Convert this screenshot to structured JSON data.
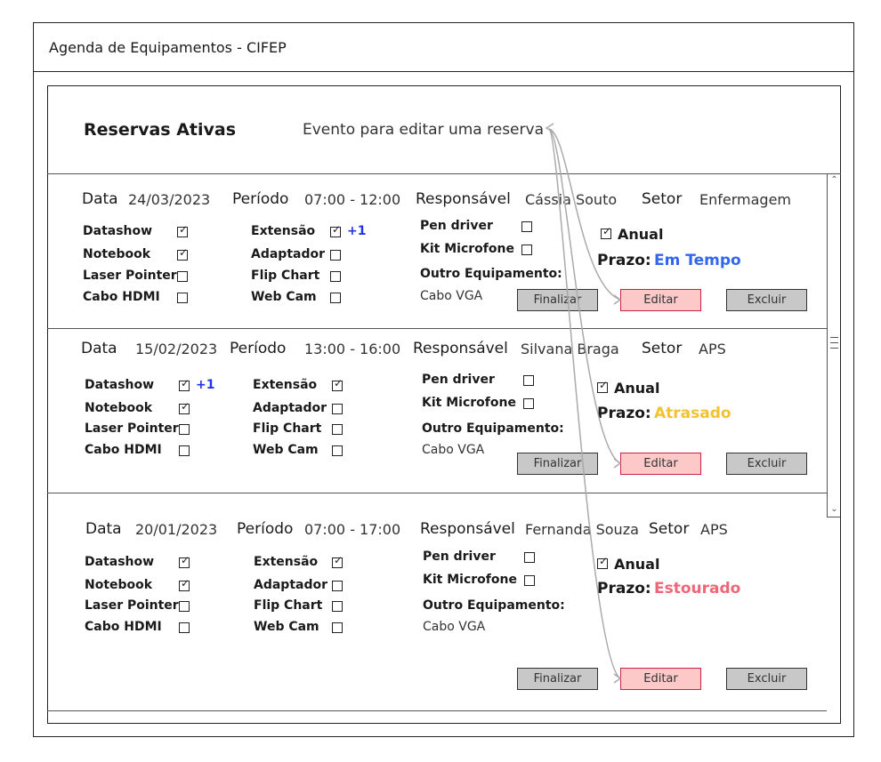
{
  "app": {
    "title": "Agenda de Equipamentos - CIFEP"
  },
  "header": {
    "section_title": "Reservas Ativas",
    "annotation": "Evento para editar uma reserva"
  },
  "labels": {
    "data": "Data",
    "periodo": "Período",
    "responsavel": "Responsável",
    "setor": "Setor",
    "outro_equipamento": "Outro Equipamento:",
    "anual": "Anual",
    "prazo": "Prazo:",
    "finalizar": "Finalizar",
    "editar": "Editar",
    "excluir": "Excluir",
    "plus_one": "+1"
  },
  "equipment_labels": {
    "datashow": "Datashow",
    "notebook": "Notebook",
    "laser_pointer": "Laser Pointer",
    "cabo_hdmi": "Cabo HDMI",
    "extensao": "Extensão",
    "adaptador": "Adaptador",
    "flip_chart": "Flip Chart",
    "web_cam": "Web Cam",
    "pen_driver": "Pen driver",
    "kit_microfone": "Kit Microfone"
  },
  "reservations": [
    {
      "date": "24/03/2023",
      "period": "07:00 - 12:00",
      "responsible": "Cássia Souto",
      "sector": "Enfermagem",
      "other_equipment": "Cabo VGA",
      "annual": true,
      "deadline_status": "Em Tempo",
      "deadline_color": "#3366ee",
      "checked": {
        "datashow": true,
        "notebook": true,
        "laser_pointer": false,
        "cabo_hdmi": false,
        "extensao": true,
        "adaptador": false,
        "flip_chart": false,
        "web_cam": false,
        "pen_driver": false,
        "kit_microfone": false
      },
      "plus_one_on": "extensao"
    },
    {
      "date": "15/02/2023",
      "period": "13:00 - 16:00",
      "responsible": "Silvana Braga",
      "sector": "APS",
      "other_equipment": "Cabo VGA",
      "annual": true,
      "deadline_status": "Atrasado",
      "deadline_color": "#f2c230",
      "checked": {
        "datashow": true,
        "notebook": true,
        "laser_pointer": false,
        "cabo_hdmi": false,
        "extensao": true,
        "adaptador": false,
        "flip_chart": false,
        "web_cam": false,
        "pen_driver": false,
        "kit_microfone": false
      },
      "plus_one_on": "datashow"
    },
    {
      "date": "20/01/2023",
      "period": "07:00 - 17:00",
      "responsible": "Fernanda Souza",
      "sector": "APS",
      "other_equipment": "Cabo VGA",
      "annual": true,
      "deadline_status": "Estourado",
      "deadline_color": "#ee6677",
      "checked": {
        "datashow": true,
        "notebook": true,
        "laser_pointer": false,
        "cabo_hdmi": false,
        "extensao": true,
        "adaptador": false,
        "flip_chart": false,
        "web_cam": false,
        "pen_driver": false,
        "kit_microfone": false
      },
      "plus_one_on": null
    }
  ],
  "colors": {
    "finalizar_bg": "#c8c8c8",
    "editar_bg": "#fcc8c8",
    "editar_border": "#cc2244",
    "excluir_bg": "#c8c8c8",
    "plus_one": "#2233ee"
  }
}
